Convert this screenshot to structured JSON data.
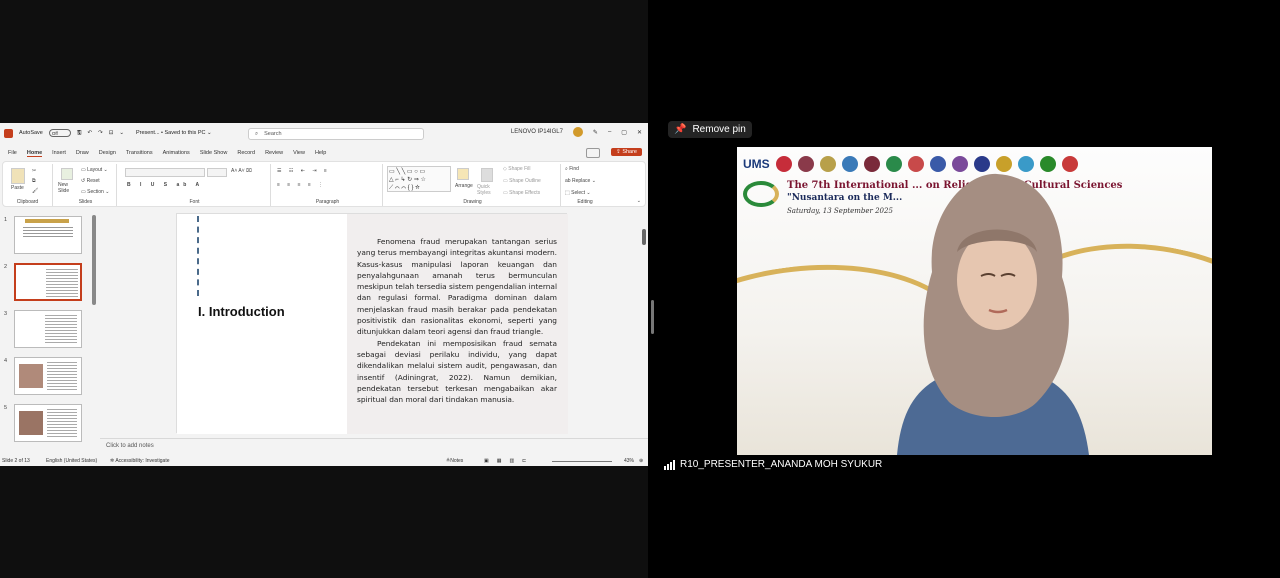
{
  "ppt": {
    "autosave": "AutoSave",
    "toggle": "Off",
    "doc_title": "Present... • Saved to this PC ⌄",
    "search_placeholder": "Search",
    "device": "LENOVO IP14IGL7",
    "menu": [
      "File",
      "Home",
      "Insert",
      "Draw",
      "Design",
      "Transitions",
      "Animations",
      "Slide Show",
      "Record",
      "Review",
      "View",
      "Help"
    ],
    "share": "Share",
    "ribbon": {
      "paste": "Paste",
      "clipboard": "Clipboard",
      "new_slide": "New Slide",
      "layout": "Layout",
      "reset": "Reset",
      "section": "Section",
      "slides": "Slides",
      "font": "Font",
      "paragraph": "Paragraph",
      "arrange": "Arrange",
      "quick_styles": "Quick Styles",
      "shape_fill": "Shape Fill",
      "shape_outline": "Shape Outline",
      "shape_effects": "Shape Effects",
      "drawing": "Drawing",
      "find": "Find",
      "replace": "Replace",
      "select": "Select",
      "editing": "Editing"
    },
    "thumb_numbers": [
      "1",
      "2",
      "3",
      "4",
      "5"
    ],
    "slide": {
      "title": "I. Introduction",
      "para1": "Fenomena fraud merupakan tantangan serius yang terus membayangi integritas akuntansi modern. Kasus-kasus manipulasi laporan keuangan dan penyalahgunaan amanah terus bermunculan meskipun telah tersedia sistem pengendalian internal dan regulasi formal. Paradigma dominan dalam menjelaskan fraud masih berakar pada pendekatan positivistik dan rasionalitas ekonomi, seperti yang ditunjukkan dalam teori agensi dan fraud triangle.",
      "para2": "Pendekatan ini memposisikan fraud semata sebagai deviasi perilaku individu, yang dapat dikendalikan melalui sistem audit, pengawasan, dan insentif (Adiningrat, 2022). Namun demikian, pendekatan tersebut terkesan mengabaikan akar spiritual dan moral dari tindakan manusia."
    },
    "notes_placeholder": "Click to add notes",
    "status": {
      "slide_of": "Slide 2 of 13",
      "language": "English (United States)",
      "accessibility": "Accessibility: Investigate",
      "notes": "Notes",
      "zoom": "43%"
    }
  },
  "video": {
    "remove_pin": "Remove pin",
    "participant": "R10_PRESENTER_ANANDA MOH SYUKUR",
    "banner_title": "The 7th International ... on Religious and Cultural Sciences",
    "banner_sub": "\"Nusantara on the M...",
    "banner_date": "Saturday, 13 September 2025",
    "banner_left": "UMS"
  }
}
